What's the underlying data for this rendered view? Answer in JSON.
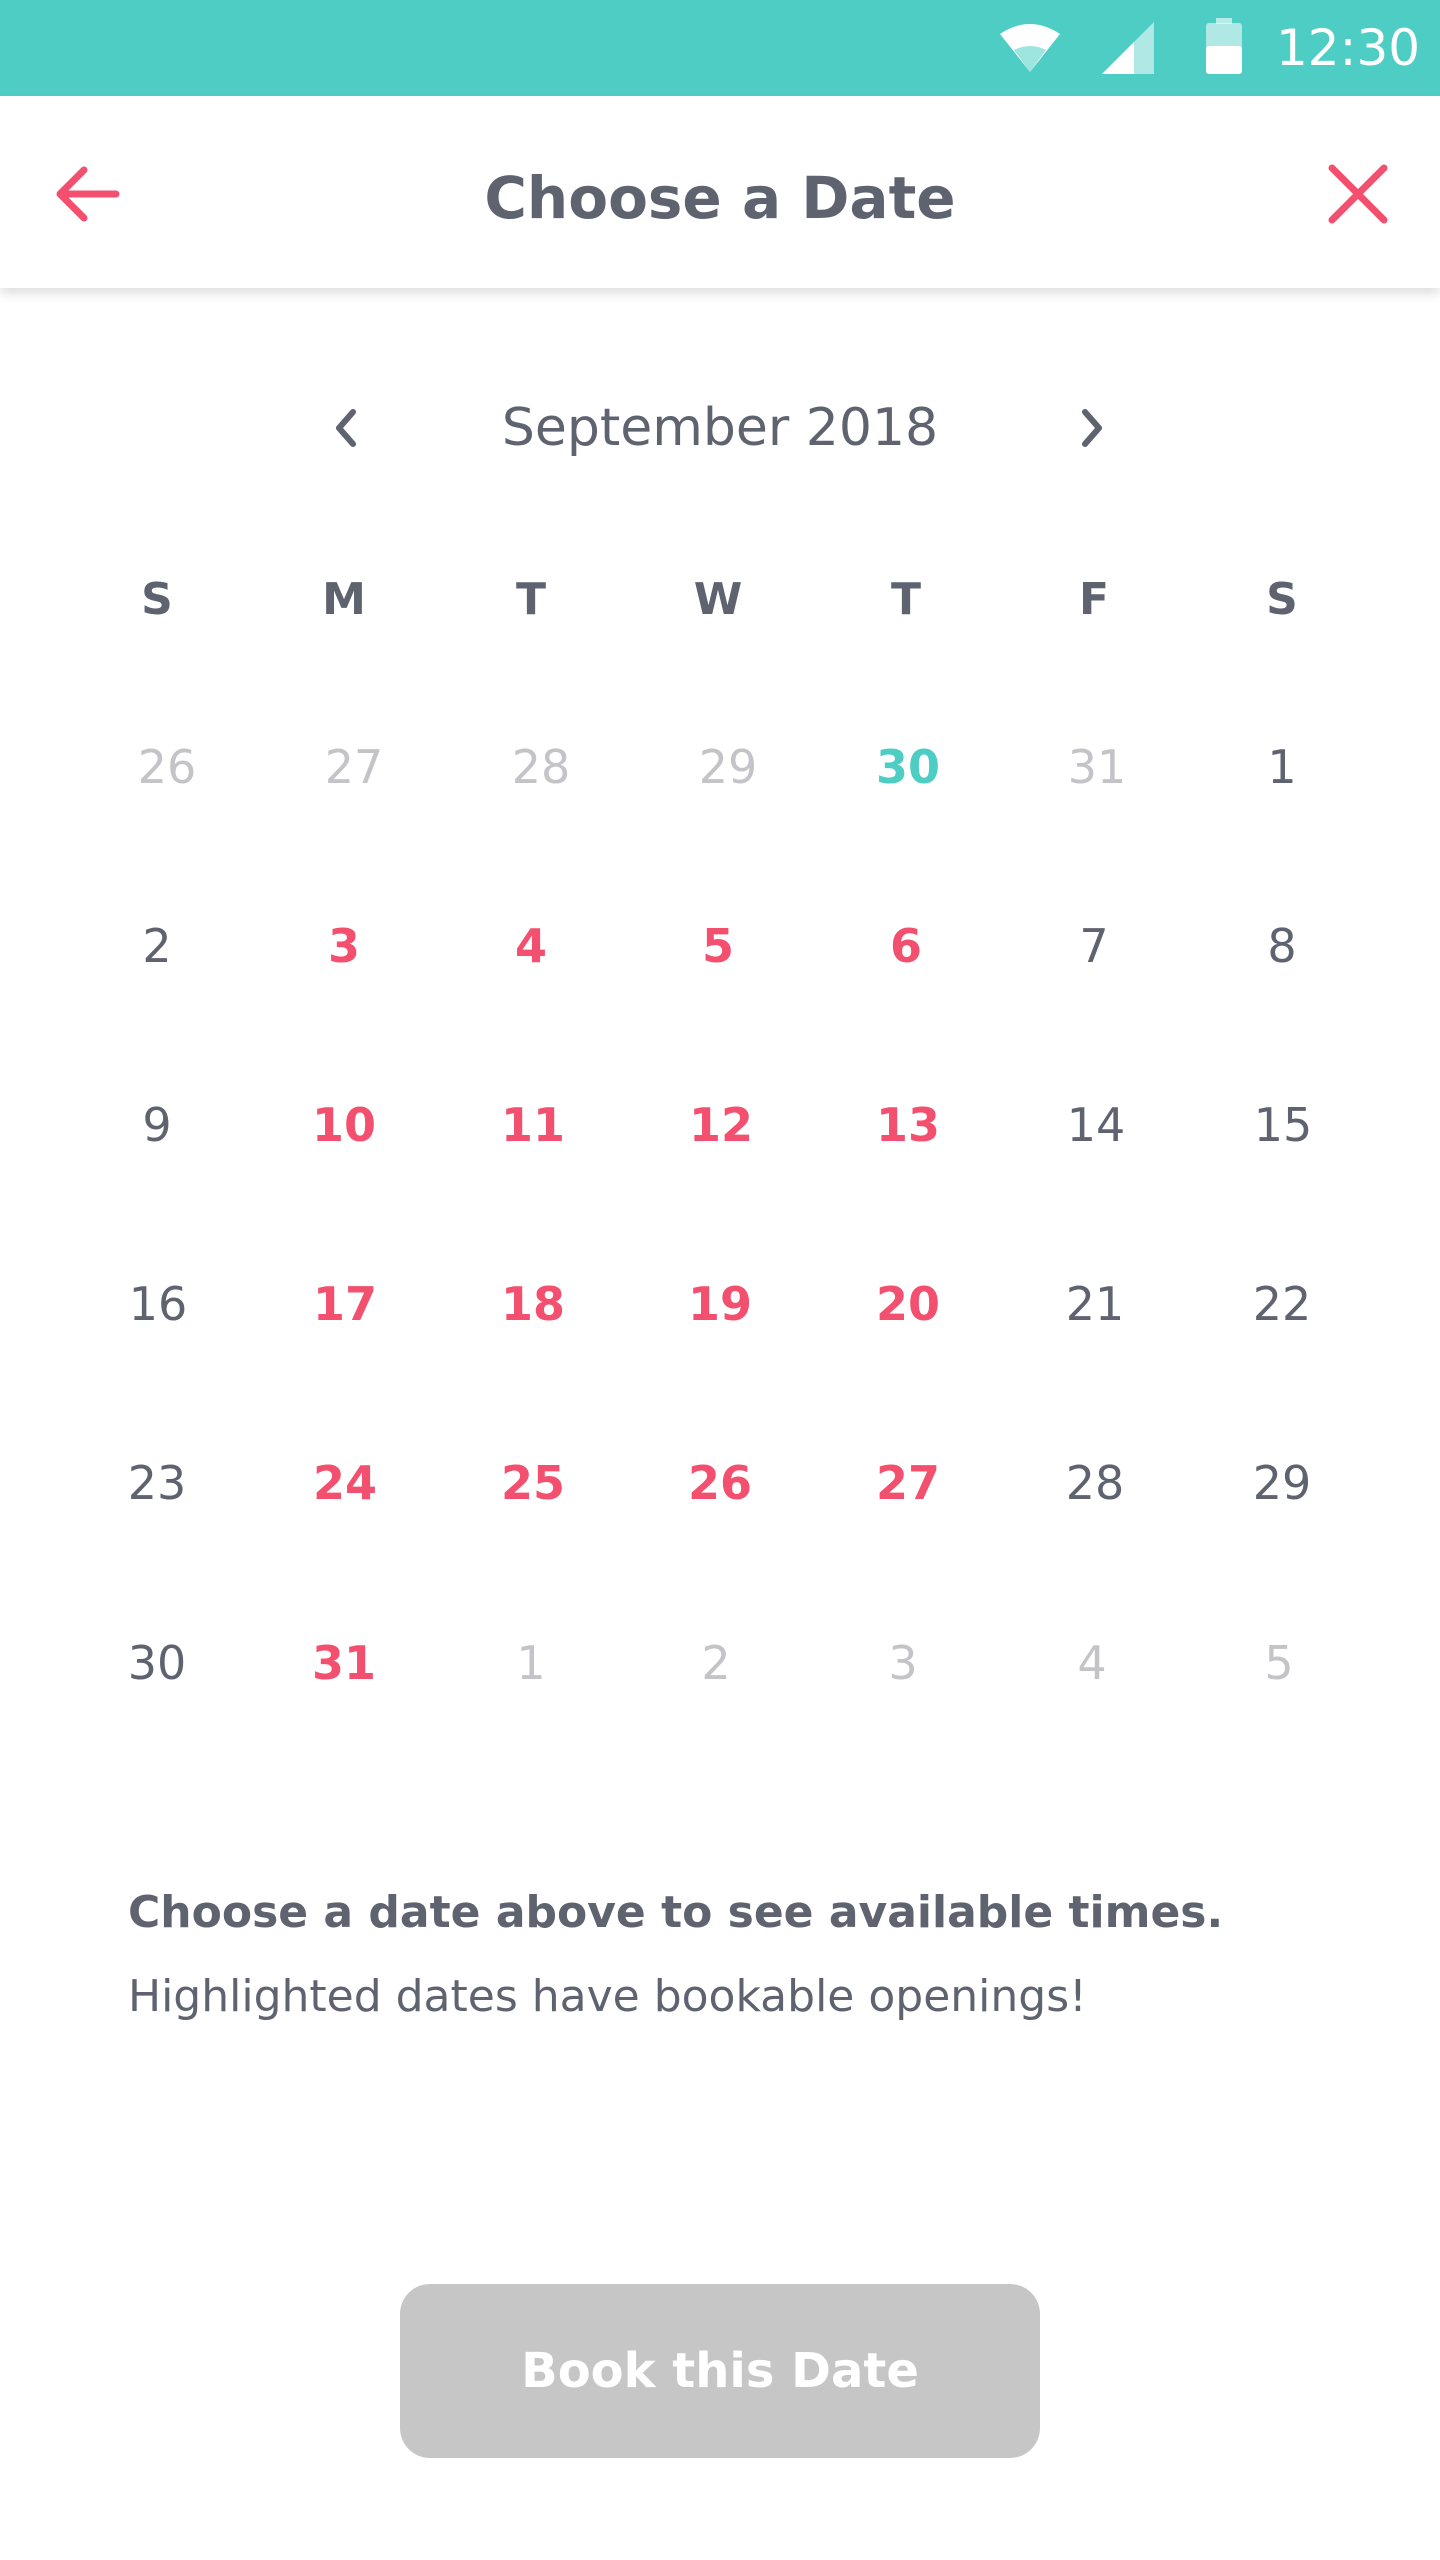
{
  "status_bar": {
    "time": "12:30",
    "icons": [
      "wifi-icon",
      "signal-icon",
      "battery-icon"
    ],
    "background": "#4ecdc4"
  },
  "header": {
    "title": "Choose a Date",
    "back_icon": "arrow-left-icon",
    "close_icon": "close-icon",
    "accent_color": "#f2506e"
  },
  "calendar": {
    "month_label": "September 2018",
    "prev_icon": "chevron-left-icon",
    "next_icon": "chevron-right-icon",
    "weekdays": [
      "S",
      "M",
      "T",
      "W",
      "T",
      "F",
      "S"
    ],
    "weeks": [
      [
        {
          "d": "26",
          "s": "outside"
        },
        {
          "d": "27",
          "s": "outside"
        },
        {
          "d": "28",
          "s": "outside"
        },
        {
          "d": "29",
          "s": "outside"
        },
        {
          "d": "30",
          "s": "today"
        },
        {
          "d": "31",
          "s": "outside"
        },
        {
          "d": "1",
          "s": "normal"
        }
      ],
      [
        {
          "d": "2",
          "s": "normal"
        },
        {
          "d": "3",
          "s": "available"
        },
        {
          "d": "4",
          "s": "available"
        },
        {
          "d": "5",
          "s": "available"
        },
        {
          "d": "6",
          "s": "available"
        },
        {
          "d": "7",
          "s": "normal"
        },
        {
          "d": "8",
          "s": "normal"
        }
      ],
      [
        {
          "d": "9",
          "s": "normal"
        },
        {
          "d": "10",
          "s": "available"
        },
        {
          "d": "11",
          "s": "available"
        },
        {
          "d": "12",
          "s": "available"
        },
        {
          "d": "13",
          "s": "available"
        },
        {
          "d": "14",
          "s": "normal"
        },
        {
          "d": "15",
          "s": "normal"
        }
      ],
      [
        {
          "d": "16",
          "s": "normal"
        },
        {
          "d": "17",
          "s": "available"
        },
        {
          "d": "18",
          "s": "available"
        },
        {
          "d": "19",
          "s": "available"
        },
        {
          "d": "20",
          "s": "available"
        },
        {
          "d": "21",
          "s": "normal"
        },
        {
          "d": "22",
          "s": "normal"
        }
      ],
      [
        {
          "d": "23",
          "s": "normal"
        },
        {
          "d": "24",
          "s": "available"
        },
        {
          "d": "25",
          "s": "available"
        },
        {
          "d": "26",
          "s": "available"
        },
        {
          "d": "27",
          "s": "available"
        },
        {
          "d": "28",
          "s": "normal"
        },
        {
          "d": "29",
          "s": "normal"
        }
      ],
      [
        {
          "d": "30",
          "s": "normal"
        },
        {
          "d": "31",
          "s": "available"
        },
        {
          "d": "1",
          "s": "outside"
        },
        {
          "d": "2",
          "s": "outside"
        },
        {
          "d": "3",
          "s": "outside"
        },
        {
          "d": "4",
          "s": "outside"
        },
        {
          "d": "5",
          "s": "outside"
        }
      ]
    ],
    "colors": {
      "available": "#f2506e",
      "today": "#4ecdc4",
      "outside": "#c4c4c8",
      "normal": "#5f6370"
    }
  },
  "info": {
    "heading": "Choose a date above to see available times.",
    "subtext": "Highlighted dates have bookable openings!"
  },
  "book_button": {
    "label": "Book this Date",
    "state": "disabled",
    "background": "#c6c6c6"
  }
}
